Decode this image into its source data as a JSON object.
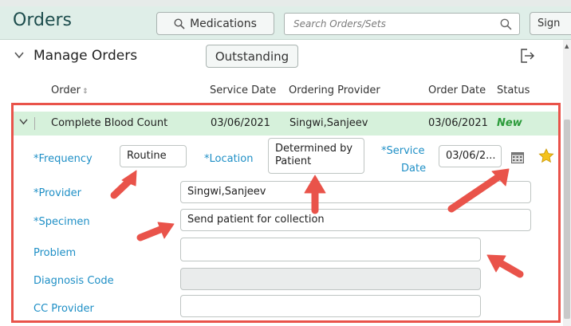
{
  "header": {
    "title": "Orders",
    "medications_label": "Medications",
    "search_placeholder": "Search Orders/Sets",
    "sign_label": "Sign"
  },
  "subheader": {
    "title": "Manage Orders",
    "outstanding_label": "Outstanding"
  },
  "columns": {
    "order": "Order",
    "service_date": "Service Date",
    "ordering_provider": "Ordering Provider",
    "order_date": "Order Date",
    "status": "Status"
  },
  "order": {
    "name": "Complete Blood Count",
    "service_date": "03/06/2021",
    "provider": "Singwi,Sanjeev",
    "order_date": "03/06/2021",
    "status": "New"
  },
  "form": {
    "frequency_label": "*Frequency",
    "frequency_value": "Routine",
    "location_label": "*Location",
    "location_value": "Determined by Patient",
    "service_label_1": "*Service",
    "service_label_2": "Date",
    "service_value": "03/06/2...",
    "provider_label": "*Provider",
    "provider_value": "Singwi,Sanjeev",
    "specimen_label": "*Specimen",
    "specimen_value": "Send patient for collection",
    "problem_label": "Problem",
    "problem_value": "",
    "diagnosis_label": "Diagnosis Code",
    "diagnosis_value": "",
    "cc_label": "CC Provider",
    "cc_value": ""
  },
  "colors": {
    "accent_blue": "#1e8fc6",
    "header_green": "#dfeee8",
    "row_green": "#d6f1db",
    "status_green": "#2b9b3a",
    "annotation_red": "#e9534a"
  },
  "icons": [
    "search-icon",
    "chevron-down-icon",
    "export-icon",
    "sort-icon",
    "calendar-icon",
    "star-icon",
    "arrow-annotation"
  ]
}
